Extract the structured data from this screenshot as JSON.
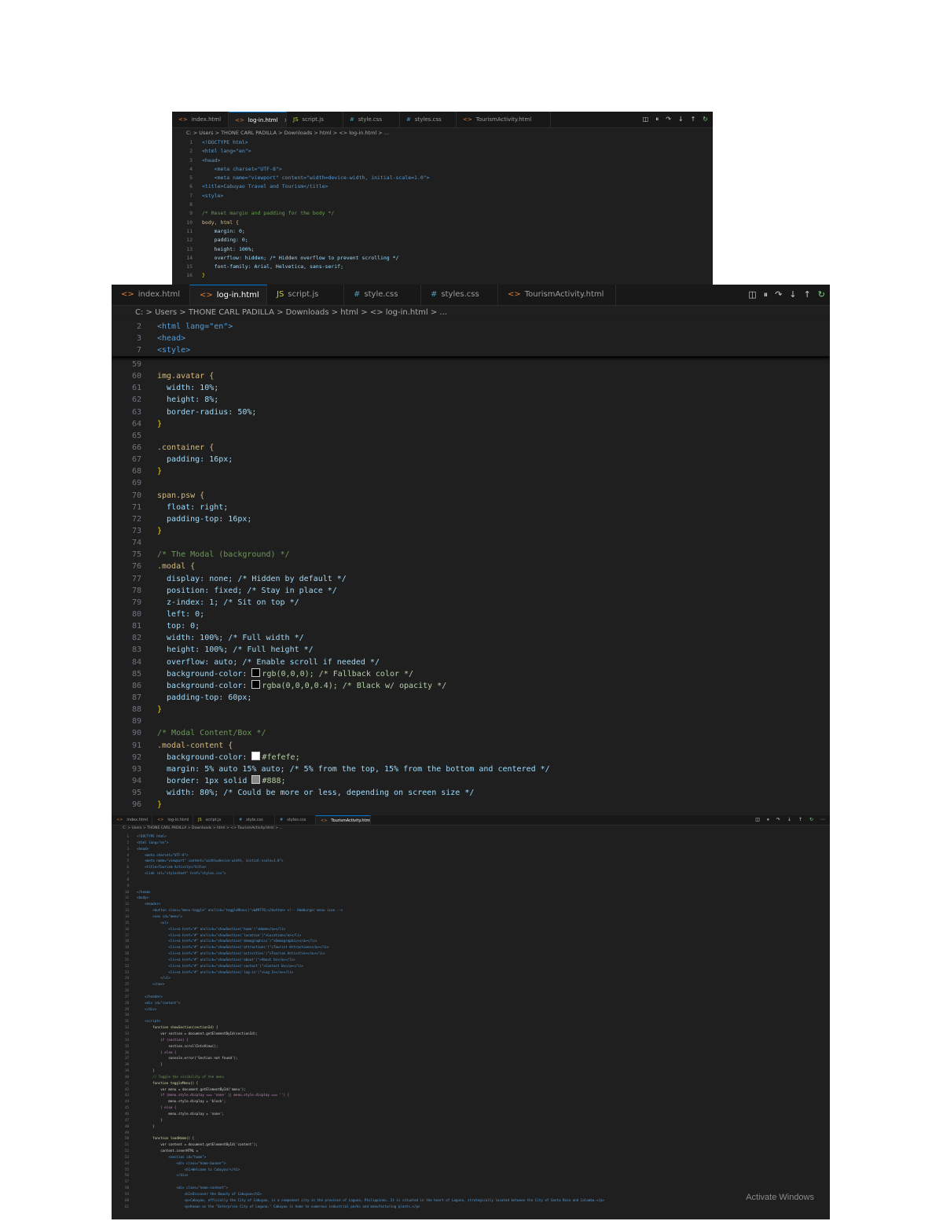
{
  "screens": [
    {
      "tabs": [
        {
          "icon": "html-icon",
          "label": "index.html",
          "active": false
        },
        {
          "icon": "html-icon",
          "label": "log-in.html",
          "active": true
        },
        {
          "icon": "js-icon",
          "label": "script.js",
          "active": false
        },
        {
          "icon": "css-icon",
          "label": "style.css",
          "active": false
        },
        {
          "icon": "css-icon",
          "label": "styles.css",
          "active": false
        },
        {
          "icon": "html-icon",
          "label": "TourismActivity.html",
          "active": false
        }
      ],
      "tab_close_glyph": "×",
      "toolbar": [
        "split-icon",
        "pause-icon",
        "step-over-icon",
        "step-into-icon",
        "step-out-icon",
        "restart-icon"
      ],
      "breadcrumb": "C: > Users > THONE CARL PADILLA > Downloads > html > <> log-in.html > ...",
      "sticky_lines": [],
      "lines": [
        {
          "n": "1",
          "t": "<!DOCTYPE html>",
          "c": "tag"
        },
        {
          "n": "2",
          "t": "<html lang=\"en\">",
          "c": "tag"
        },
        {
          "n": "3",
          "t": "<head>",
          "c": "tag"
        },
        {
          "n": "4",
          "t": "    <meta charset=\"UTF-8\">",
          "c": "tag"
        },
        {
          "n": "5",
          "t": "    <meta name=\"viewport\" content=\"width=device-width, initial-scale=1.0\">",
          "c": "tag"
        },
        {
          "n": "6",
          "t": "<title>Cabuyao Travel and Tourism</title>",
          "c": "tag"
        },
        {
          "n": "7",
          "t": "<style>",
          "c": "tag"
        },
        {
          "n": "8",
          "t": "",
          "c": "def"
        },
        {
          "n": "9",
          "t": "/* Reset margin and padding for the body */",
          "c": "com"
        },
        {
          "n": "10",
          "t": "body, html {",
          "c": "sel"
        },
        {
          "n": "11",
          "t": "    margin: 0;",
          "c": "prop"
        },
        {
          "n": "12",
          "t": "    padding: 0;",
          "c": "prop"
        },
        {
          "n": "13",
          "t": "    height: 100%;",
          "c": "prop"
        },
        {
          "n": "14",
          "t": "    overflow: hidden; /* Hidden overflow to prevent scrolling */",
          "c": "prop"
        },
        {
          "n": "15",
          "t": "    font-family: Arial, Helvetica, sans-serif;",
          "c": "prop"
        },
        {
          "n": "16",
          "t": "}",
          "c": "br"
        }
      ]
    },
    {
      "tabs": [
        {
          "icon": "html-icon",
          "label": "index.html",
          "active": false
        },
        {
          "icon": "html-icon",
          "label": "log-in.html",
          "active": true
        },
        {
          "icon": "js-icon",
          "label": "script.js",
          "active": false
        },
        {
          "icon": "css-icon",
          "label": "style.css",
          "active": false
        },
        {
          "icon": "css-icon",
          "label": "styles.css",
          "active": false
        },
        {
          "icon": "html-icon",
          "label": "TourismActivity.html",
          "active": false
        }
      ],
      "tab_close_glyph": "×",
      "toolbar": [
        "split-icon",
        "pause-icon",
        "step-over-icon",
        "step-into-icon",
        "step-out-icon",
        "restart-icon"
      ],
      "breadcrumb": "C: > Users > THONE CARL PADILLA > Downloads > html > <> log-in.html > ...",
      "sticky_lines": [
        {
          "n": "2",
          "t": "<html lang=\"en\">",
          "c": "tag"
        },
        {
          "n": "3",
          "t": "<head>",
          "c": "tag"
        },
        {
          "n": "7",
          "t": "<style>",
          "c": "tag"
        }
      ],
      "lines": [
        {
          "n": "59",
          "t": "",
          "c": "def"
        },
        {
          "n": "60",
          "t": "img.avatar {",
          "c": "sel"
        },
        {
          "n": "61",
          "t": "  width: 10%;",
          "c": "prop"
        },
        {
          "n": "62",
          "t": "  height: 8%;",
          "c": "prop"
        },
        {
          "n": "63",
          "t": "  border-radius: 50%;",
          "c": "prop"
        },
        {
          "n": "64",
          "t": "}",
          "c": "br"
        },
        {
          "n": "65",
          "t": "",
          "c": "def"
        },
        {
          "n": "66",
          "t": ".container {",
          "c": "sel"
        },
        {
          "n": "67",
          "t": "  padding: 16px;",
          "c": "prop"
        },
        {
          "n": "68",
          "t": "}",
          "c": "br"
        },
        {
          "n": "69",
          "t": "",
          "c": "def"
        },
        {
          "n": "70",
          "t": "span.psw {",
          "c": "sel"
        },
        {
          "n": "71",
          "t": "  float: right;",
          "c": "prop"
        },
        {
          "n": "72",
          "t": "  padding-top: 16px;",
          "c": "prop"
        },
        {
          "n": "73",
          "t": "}",
          "c": "br"
        },
        {
          "n": "74",
          "t": "",
          "c": "def"
        },
        {
          "n": "75",
          "t": "/* The Modal (background) */",
          "c": "com"
        },
        {
          "n": "76",
          "t": ".modal {",
          "c": "sel"
        },
        {
          "n": "77",
          "t": "  display: none; /* Hidden by default */",
          "c": "prop"
        },
        {
          "n": "78",
          "t": "  position: fixed; /* Stay in place */",
          "c": "prop"
        },
        {
          "n": "79",
          "t": "  z-index: 1; /* Sit on top */",
          "c": "prop"
        },
        {
          "n": "80",
          "t": "  left: 0;",
          "c": "prop"
        },
        {
          "n": "81",
          "t": "  top: 0;",
          "c": "prop"
        },
        {
          "n": "82",
          "t": "  width: 100%; /* Full width */",
          "c": "prop"
        },
        {
          "n": "83",
          "t": "  height: 100%; /* Full height */",
          "c": "prop"
        },
        {
          "n": "84",
          "t": "  overflow: auto; /* Enable scroll if needed */",
          "c": "prop"
        },
        {
          "n": "85",
          "t": "  background-color: rgb(0,0,0); /* Fallback color */",
          "c": "prop",
          "swatch": "#000000"
        },
        {
          "n": "86",
          "t": "  background-color: rgba(0,0,0,0.4); /* Black w/ opacity */",
          "c": "prop",
          "swatch": "#000000"
        },
        {
          "n": "87",
          "t": "  padding-top: 60px;",
          "c": "prop"
        },
        {
          "n": "88",
          "t": "}",
          "c": "br"
        },
        {
          "n": "89",
          "t": "",
          "c": "def"
        },
        {
          "n": "90",
          "t": "/* Modal Content/Box */",
          "c": "com"
        },
        {
          "n": "91",
          "t": ".modal-content {",
          "c": "sel"
        },
        {
          "n": "92",
          "t": "  background-color: #fefefe;",
          "c": "prop",
          "swatch": "#fefefe"
        },
        {
          "n": "93",
          "t": "  margin: 5% auto 15% auto; /* 5% from the top, 15% from the bottom and centered */",
          "c": "prop"
        },
        {
          "n": "94",
          "t": "  border: 1px solid #888;",
          "c": "prop",
          "swatch": "#888888"
        },
        {
          "n": "95",
          "t": "  width: 80%; /* Could be more or less, depending on screen size */",
          "c": "prop"
        },
        {
          "n": "96",
          "t": "}",
          "c": "br"
        }
      ]
    },
    {
      "tabs": [
        {
          "icon": "html-icon",
          "label": "index.html",
          "active": false
        },
        {
          "icon": "html-icon",
          "label": "log-in.html",
          "active": false
        },
        {
          "icon": "js-icon",
          "label": "script.js",
          "active": false
        },
        {
          "icon": "css-icon",
          "label": "style.css",
          "active": false
        },
        {
          "icon": "css-icon",
          "label": "styles.css",
          "active": false
        },
        {
          "icon": "html-icon",
          "label": "TourismActivity.html",
          "active": true
        }
      ],
      "tab_close_glyph": "×",
      "toolbar": [
        "split-icon",
        "pause-icon",
        "step-over-icon",
        "step-into-icon",
        "step-out-icon",
        "restart-icon",
        "more-icon"
      ],
      "breadcrumb": "C: > Users > THONE CARL PADILLA > Downloads > html > <> TourismActivity.html > ...",
      "sticky_lines": [],
      "lines": [
        {
          "n": "1",
          "t": "<!DOCTYPE html>",
          "c": "tag"
        },
        {
          "n": "2",
          "t": "<html lang=\"en\">",
          "c": "tag"
        },
        {
          "n": "3",
          "t": "<head>",
          "c": "tag"
        },
        {
          "n": "4",
          "t": "    <meta charset=\"UTF-8\">",
          "c": "tag"
        },
        {
          "n": "5",
          "t": "    <meta name=\"viewport\" content=\"width=device-width, initial-scale=1.0\">",
          "c": "tag"
        },
        {
          "n": "6",
          "t": "    <title>Tourism Activity</title>",
          "c": "tag"
        },
        {
          "n": "7",
          "t": "    <link rel=\"stylesheet\" href=\"styles.css\">",
          "c": "tag"
        },
        {
          "n": "8",
          "t": "",
          "c": "def"
        },
        {
          "n": "9",
          "t": "",
          "c": "def"
        },
        {
          "n": "10",
          "t": "</head>",
          "c": "tag"
        },
        {
          "n": "11",
          "t": "<body>",
          "c": "tag"
        },
        {
          "n": "12",
          "t": "    <header>",
          "c": "tag"
        },
        {
          "n": "13",
          "t": "        <button class=\"menu-toggle\" onclick=\"toggleMenu()\">&#9776;</button> <!-- Hamburger menu icon -->",
          "c": "tag"
        },
        {
          "n": "14",
          "t": "        <nav id=\"menu\">",
          "c": "tag"
        },
        {
          "n": "15",
          "t": "            <ul>",
          "c": "tag"
        },
        {
          "n": "16",
          "t": "                <li><a href=\"#\" onclick=\"showSection('home')\">Home</a></li>",
          "c": "tag"
        },
        {
          "n": "17",
          "t": "                <li><a href=\"#\" onclick=\"showSection('location')\">Location</a></li>",
          "c": "tag"
        },
        {
          "n": "18",
          "t": "                <li><a href=\"#\" onclick=\"showSection('demographics')\">Demographics</a></li>",
          "c": "tag"
        },
        {
          "n": "19",
          "t": "                <li><a href=\"#\" onclick=\"showSection('attractions')\">Tourist Attractions</a></li>",
          "c": "tag"
        },
        {
          "n": "20",
          "t": "                <li><a href=\"#\" onclick=\"showSection('activities')\">Tourism Activities</a></li>",
          "c": "tag"
        },
        {
          "n": "21",
          "t": "                <li><a href=\"#\" onclick=\"showSection('about')\">About Us</a></li>",
          "c": "tag"
        },
        {
          "n": "22",
          "t": "                <li><a href=\"#\" onclick=\"showSection('contact')\">Contact Us</a></li>",
          "c": "tag"
        },
        {
          "n": "23",
          "t": "                <li><a href=\"#\" onclick=\"showSection('log-in')\">Log In</a></li>",
          "c": "tag"
        },
        {
          "n": "24",
          "t": "            </ul>",
          "c": "tag"
        },
        {
          "n": "25",
          "t": "        </nav>",
          "c": "tag"
        },
        {
          "n": "26",
          "t": "",
          "c": "def"
        },
        {
          "n": "27",
          "t": "    </header>",
          "c": "tag"
        },
        {
          "n": "28",
          "t": "    <div id=\"content\">",
          "c": "tag"
        },
        {
          "n": "29",
          "t": "    </div>",
          "c": "tag"
        },
        {
          "n": "30",
          "t": "",
          "c": "def"
        },
        {
          "n": "31",
          "t": "    <script>",
          "c": "tag"
        },
        {
          "n": "32",
          "t": "        function showSection(sectionId) {",
          "c": "fn"
        },
        {
          "n": "33",
          "t": "            var section = document.getElementById(sectionId);",
          "c": "def"
        },
        {
          "n": "34",
          "t": "            if (section) {",
          "c": "kw"
        },
        {
          "n": "35",
          "t": "                section.scrollIntoView();",
          "c": "def"
        },
        {
          "n": "36",
          "t": "            } else {",
          "c": "kw"
        },
        {
          "n": "37",
          "t": "                console.error('Section not found');",
          "c": "def"
        },
        {
          "n": "38",
          "t": "            }",
          "c": "br"
        },
        {
          "n": "39",
          "t": "        }",
          "c": "br"
        },
        {
          "n": "40",
          "t": "        // Toggle the visibility of the menu",
          "c": "com"
        },
        {
          "n": "41",
          "t": "        function toggleMenu() {",
          "c": "fn"
        },
        {
          "n": "42",
          "t": "            var menu = document.getElementById('menu');",
          "c": "def"
        },
        {
          "n": "43",
          "t": "            if (menu.style.display === 'none' || menu.style.display === '') {",
          "c": "kw"
        },
        {
          "n": "44",
          "t": "                menu.style.display = 'block';",
          "c": "def"
        },
        {
          "n": "45",
          "t": "            } else {",
          "c": "kw"
        },
        {
          "n": "46",
          "t": "                menu.style.display = 'none';",
          "c": "def"
        },
        {
          "n": "47",
          "t": "            }",
          "c": "br"
        },
        {
          "n": "48",
          "t": "        }",
          "c": "br"
        },
        {
          "n": "49",
          "t": "",
          "c": "def"
        },
        {
          "n": "50",
          "t": "        function loadHome() {",
          "c": "fn"
        },
        {
          "n": "51",
          "t": "            var content = document.getElementById('content');",
          "c": "def"
        },
        {
          "n": "52",
          "t": "            content.innerHTML = `",
          "c": "def"
        },
        {
          "n": "53",
          "t": "                <section id=\"home\">",
          "c": "tag"
        },
        {
          "n": "54",
          "t": "                    <div class=\"home-banner\">",
          "c": "tag"
        },
        {
          "n": "55",
          "t": "                        <h1>Welcome to Cabuyao!</h1>",
          "c": "tag"
        },
        {
          "n": "56",
          "t": "                    </div>",
          "c": "tag"
        },
        {
          "n": "57",
          "t": "",
          "c": "def"
        },
        {
          "n": "58",
          "t": "                    <div class=\"home-content\">",
          "c": "tag"
        },
        {
          "n": "59",
          "t": "                        <h2>Discover the Beauty of Cabuyao</h2>",
          "c": "tag"
        },
        {
          "n": "60",
          "t": "                        <p>Cabuyao, officially the City of Cabuyao, is a component city in the province of Laguna, Philippines. It is situated in the heart of Laguna, strategically located between the City of Santa Rosa and Calamba.</p>",
          "c": "tag"
        },
        {
          "n": "61",
          "t": "                        <p>Known as the \"Enterprise City of Laguna,\" Cabuyao is home to numerous industrial parks and manufacturing plants.</p>",
          "c": "tag"
        }
      ]
    }
  ],
  "watermark": "Activate Windows"
}
